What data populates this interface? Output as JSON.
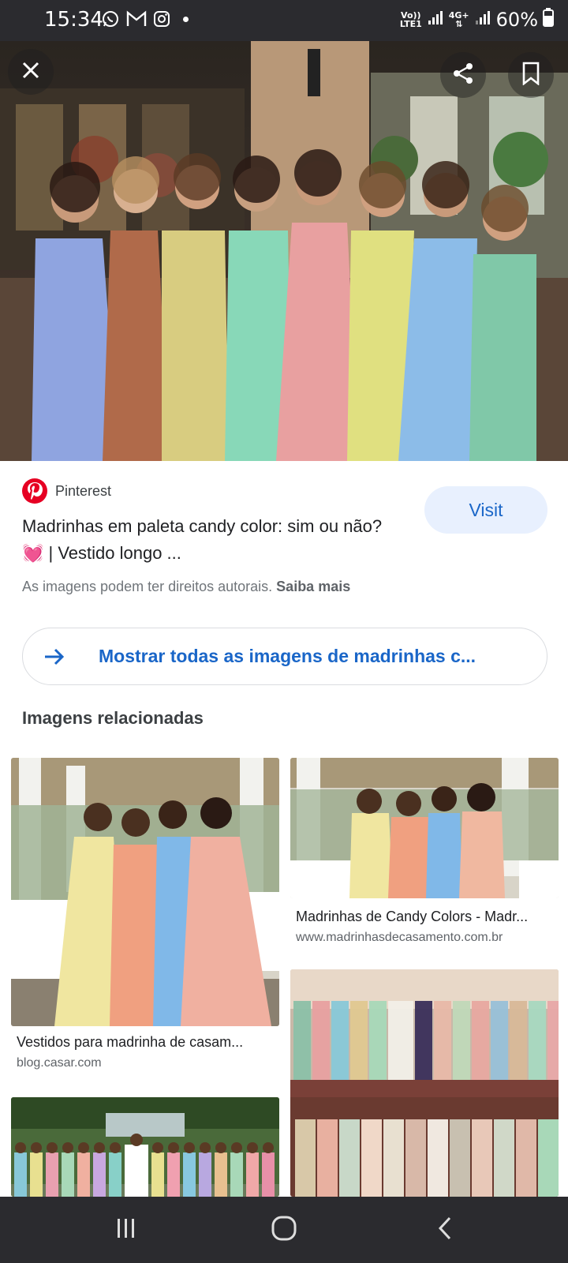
{
  "status_bar": {
    "time": "15:34",
    "network_top": "Vo))",
    "network_bottom": "LTE1",
    "data_type": "4G+",
    "battery": "60%"
  },
  "hero": {
    "close_icon": "close-icon",
    "share_icon": "share-icon",
    "bookmark_icon": "bookmark-icon"
  },
  "result": {
    "source": "Pinterest",
    "title": "Madrinhas em paleta candy color: sim ou não? 💓 | Vestido longo ...",
    "visit_label": "Visit",
    "copyright_text": "As imagens podem ter direitos autorais.",
    "copyright_link": "Saiba mais"
  },
  "show_all": {
    "label": "Mostrar todas as imagens de madrinhas c..."
  },
  "related": {
    "heading": "Imagens relacionadas",
    "items": [
      {
        "caption": "Vestidos para madrinha de casam...",
        "domain": "blog.casar.com"
      },
      {
        "caption": "Madrinhas de Candy Colors - Madr...",
        "domain": "www.madrinhasdecasamento.com.br"
      }
    ]
  },
  "colors": {
    "accent_blue": "#1a66c8",
    "visit_bg": "#e8f0fe",
    "pinterest_red": "#e60023",
    "system_bar": "#2b2b2f"
  }
}
